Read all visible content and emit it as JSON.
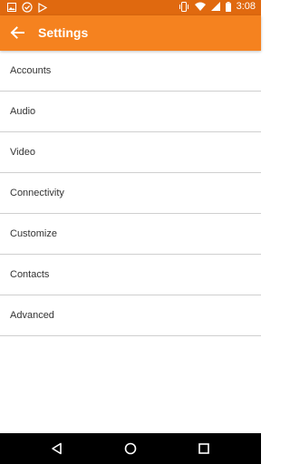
{
  "status_bar": {
    "time": "3:08",
    "left_icons": [
      "image-icon",
      "check-circle-icon",
      "play-store-icon"
    ],
    "right_icons": [
      "vibrate-icon",
      "wifi-icon",
      "signal-icon",
      "battery-icon"
    ]
  },
  "app_bar": {
    "title": "Settings",
    "back_icon": "arrow-left-icon",
    "color": "#f5821f"
  },
  "settings_items": [
    {
      "label": "Accounts"
    },
    {
      "label": "Audio"
    },
    {
      "label": "Video"
    },
    {
      "label": "Connectivity"
    },
    {
      "label": "Customize"
    },
    {
      "label": "Contacts"
    },
    {
      "label": "Advanced"
    }
  ],
  "nav_bar": {
    "buttons": [
      "back-triangle-icon",
      "home-circle-icon",
      "recents-square-icon"
    ]
  }
}
